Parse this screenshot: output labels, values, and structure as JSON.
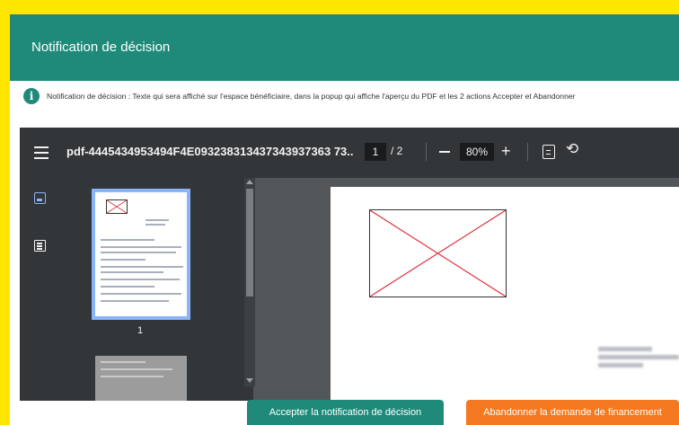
{
  "dialog": {
    "title": "Notification de décision"
  },
  "info": {
    "icon": "info-icon",
    "text": "Notification de décision : Texte qui sera affiché sur l'espace bénéficiaire, dans la popup qui affiche l'aperçu du PDF et les 2 actions Accepter et Abandonner"
  },
  "pdf_viewer": {
    "menu_icon": "hamburger-icon",
    "document_title": "pdf-4445434953494F4E093238313437343937363 73...",
    "current_page": "1",
    "page_separator": "/ 2",
    "zoom_level": "80%",
    "zoom_out_icon": "minus-icon",
    "zoom_in_icon": "plus-icon",
    "fit_icon": "fit-page-icon",
    "rotate_icon": "rotate-icon",
    "sidebar": {
      "thumbnails_icon": "image-icon",
      "outline_icon": "list-icon"
    },
    "thumbnail_page_number": "1"
  },
  "actions": {
    "accept_label": "Accepter la notification de décision",
    "abandon_label": "Abandonner la demande de financement"
  },
  "colors": {
    "page_background": "#ffe600",
    "header": "#1f8a7a",
    "accept_button": "#1f8a7a",
    "abandon_button": "#f47920",
    "toolbar": "#323639"
  }
}
